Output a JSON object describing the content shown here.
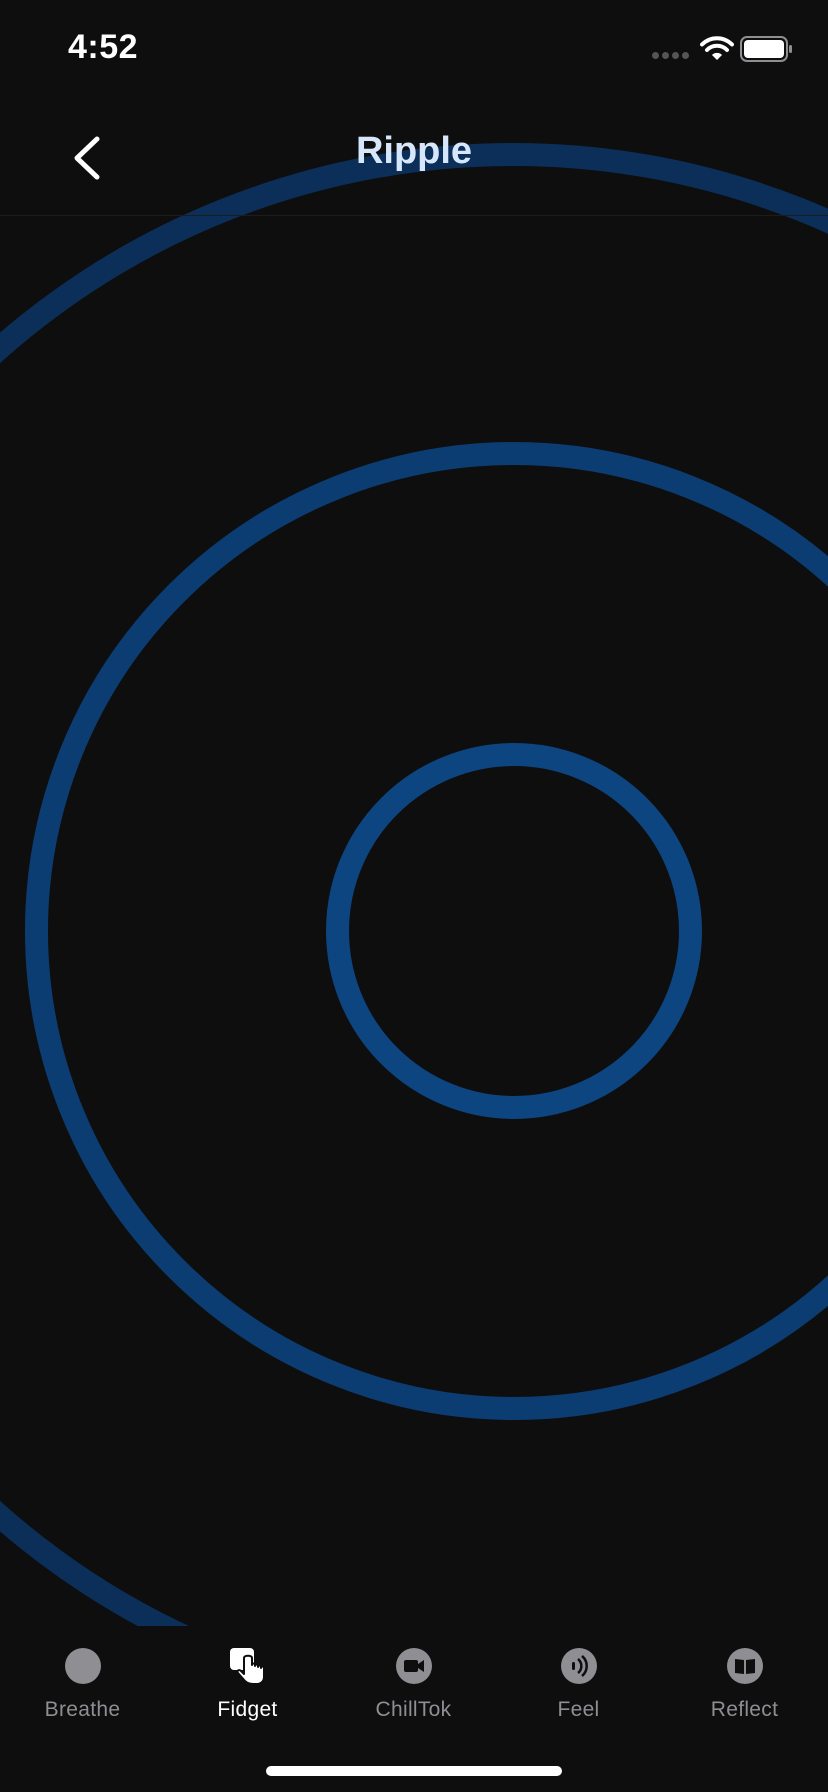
{
  "status_bar": {
    "time": "4:52",
    "icons": [
      "signal-dots-icon",
      "wifi-icon",
      "battery-icon"
    ]
  },
  "header": {
    "title": "Ripple",
    "back_icon": "chevron-left-icon"
  },
  "ripple": {
    "ring_color": "#0d4581"
  },
  "tabs": [
    {
      "label": "Breathe",
      "icon": "circle-icon",
      "active": false
    },
    {
      "label": "Fidget",
      "icon": "hand-pointer-icon",
      "active": true
    },
    {
      "label": "ChillTok",
      "icon": "video-camera-icon",
      "active": false
    },
    {
      "label": "Feel",
      "icon": "vibration-icon",
      "active": false
    },
    {
      "label": "Reflect",
      "icon": "book-icon",
      "active": false
    }
  ],
  "colors": {
    "background": "#0e0e0f",
    "accent_blue": "#0d4581",
    "title": "#d7e7fb",
    "tab_inactive": "#8e8e93",
    "tab_active": "#ffffff"
  }
}
